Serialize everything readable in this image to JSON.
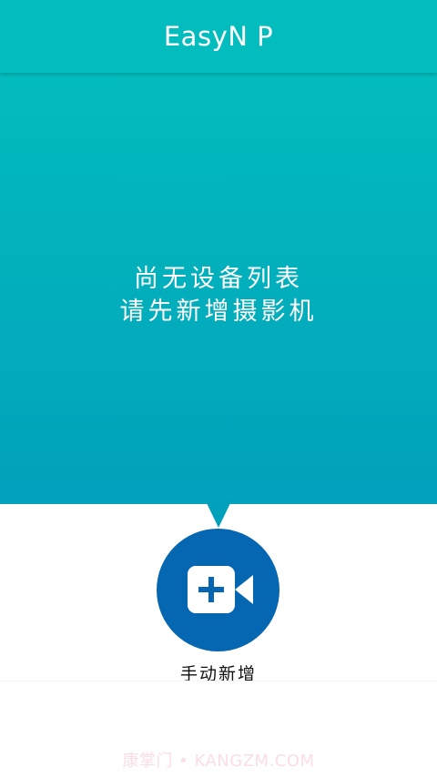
{
  "app_bar": {
    "title": "EasyN P"
  },
  "empty_state": {
    "line1": "尚无设备列表",
    "line2": "请先新增摄影机"
  },
  "add_action": {
    "label": "手动新增",
    "icon": "video-camera-add-icon"
  },
  "watermark": {
    "text": "康掌门 • KANGZM.COM"
  },
  "colors": {
    "app_bar": "#03bcbe",
    "hero_top": "#03bcbe",
    "hero_bottom": "#01a1bb",
    "button": "#0566b2",
    "watermark": "#fbdde6"
  }
}
